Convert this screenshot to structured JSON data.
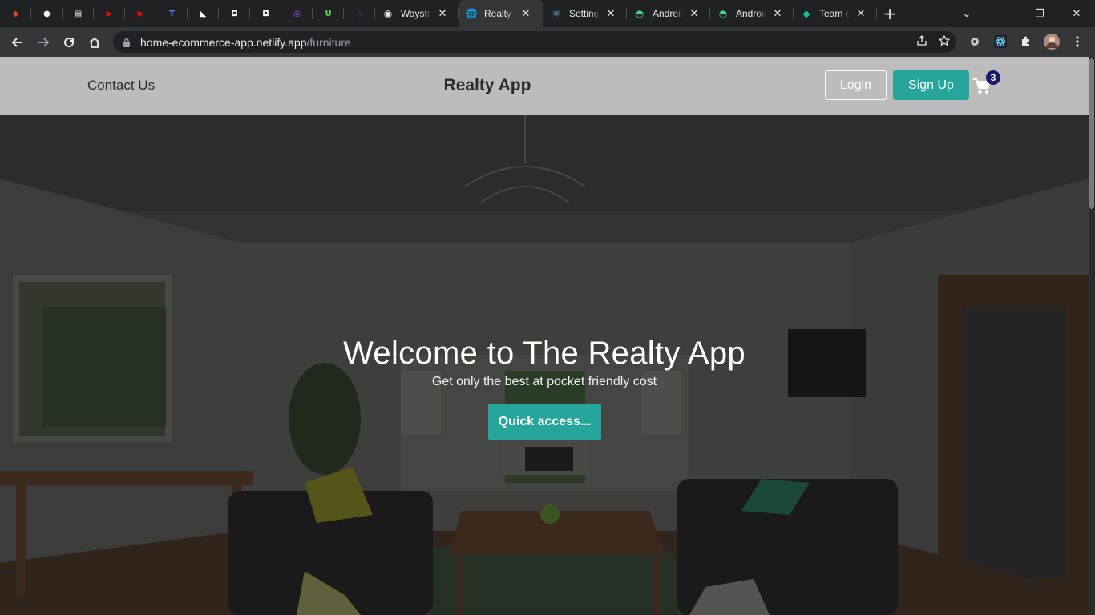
{
  "browser": {
    "pinned_tabs": [
      {
        "icon": "gitlab-icon",
        "color": "#e24329",
        "glyph": "◆"
      },
      {
        "icon": "github-icon",
        "color": "#ffffff",
        "glyph": "●"
      },
      {
        "icon": "docs-icon",
        "color": "#e8eaed",
        "glyph": "▤"
      },
      {
        "icon": "youtube-icon",
        "color": "#ff0000",
        "glyph": "▶"
      },
      {
        "icon": "youtube-icon",
        "color": "#ff0000",
        "glyph": "▶"
      },
      {
        "icon": "t-app-icon",
        "color": "#4285f4",
        "glyph": "T"
      },
      {
        "icon": "framer-icon",
        "color": "#ffffff",
        "glyph": "◣"
      },
      {
        "icon": "notion-icon",
        "color": "#ffffff",
        "glyph": "◘"
      },
      {
        "icon": "notion-icon",
        "color": "#ffffff",
        "glyph": "◘"
      },
      {
        "icon": "figma-icon",
        "color": "#a259ff",
        "glyph": "◎"
      },
      {
        "icon": "upwork-icon",
        "color": "#6fda44",
        "glyph": "U"
      },
      {
        "icon": "purple-app-icon",
        "color": "#7a2e5a",
        "glyph": "◇"
      }
    ],
    "tabs": [
      {
        "title": "Waystream",
        "icon": "radio-icon",
        "active": false
      },
      {
        "title": "Realty App",
        "icon": "globe-icon",
        "active": true
      },
      {
        "title": "Settings",
        "icon": "react-icon",
        "active": false
      },
      {
        "title": "Android",
        "icon": "android-icon",
        "active": false
      },
      {
        "title": "Android",
        "icon": "android-icon",
        "active": false
      },
      {
        "title": "Team o",
        "icon": "diamond-icon",
        "active": false
      }
    ],
    "url_host": "home-ecommerce-app.netlify.app",
    "url_path": "/furniture"
  },
  "nav": {
    "contact": "Contact Us",
    "brand": "Realty App",
    "login": "Login",
    "signup": "Sign Up",
    "cart_count": "3"
  },
  "hero": {
    "title": "Welcome to The Realty App",
    "subtitle": "Get only the best at pocket friendly cost",
    "button": "Quick access..."
  },
  "colors": {
    "accent": "#26a69a",
    "badge": "#1a1a6e",
    "navbar": "#bcbcbc"
  }
}
